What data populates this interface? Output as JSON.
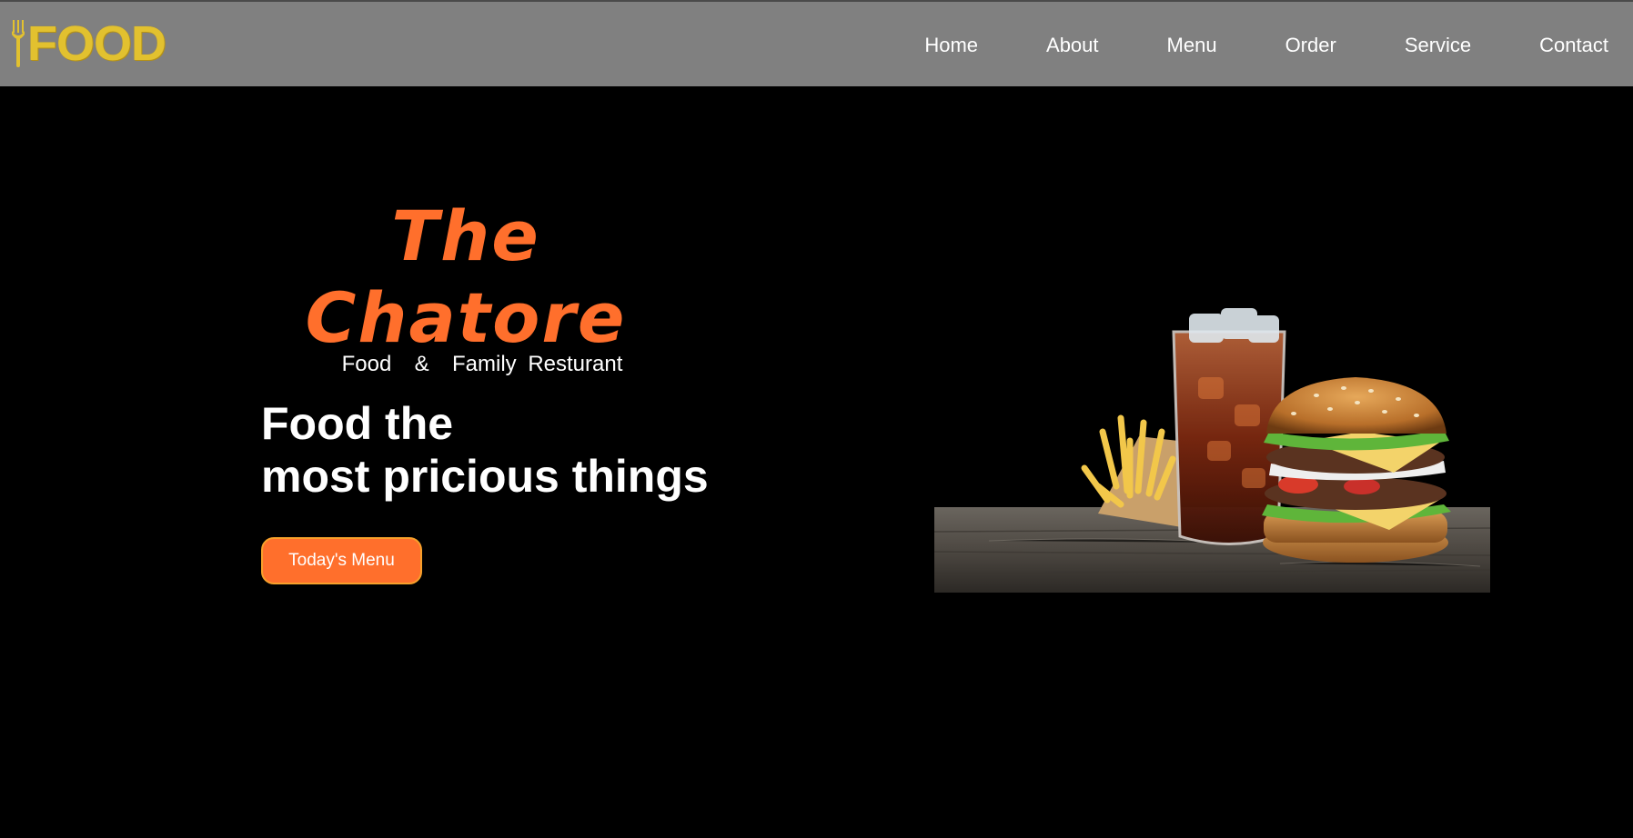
{
  "logo": {
    "text": "FOOD",
    "icon": "fork-icon",
    "color": "#e2c12f"
  },
  "nav": {
    "items": [
      {
        "label": "Home"
      },
      {
        "label": "About"
      },
      {
        "label": "Menu"
      },
      {
        "label": "Order"
      },
      {
        "label": "Service"
      },
      {
        "label": "Contact"
      }
    ]
  },
  "hero": {
    "brand_title": "The Chatore",
    "brand_subtitle": "Food  &  Family Resturant",
    "headline_line1": "Food the",
    "headline_line2": "most pricious things",
    "cta_label": "Today's Menu",
    "image": "burger-fries-cola-image"
  },
  "colors": {
    "navbar_bg": "#808080",
    "page_bg": "#000000",
    "accent": "#ff6f2c",
    "button_border": "#f7a02b"
  }
}
